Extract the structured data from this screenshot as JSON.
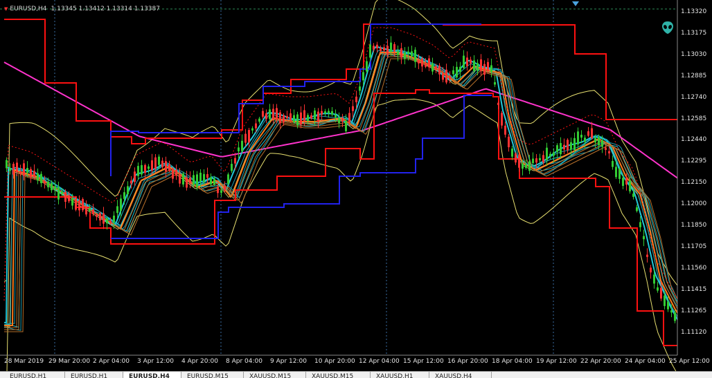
{
  "chart": {
    "symbol_line": "EURUSD,H4",
    "ohlc": "1.13345 1.13412 1.13314 1.13387",
    "colors": {
      "background": "#000000",
      "bull": "#33cc33",
      "bear": "#ff3333",
      "price_channel": "#ff1111",
      "donchian_blue": "#2222ee",
      "ma_magenta": "#ff33cc",
      "bollinger": "#e8e070",
      "cyan_ribbon": "#22c8d8",
      "orange_ribbon": "#ff7a1a",
      "grid": "#3a6ea5"
    },
    "price_axis": [
      "1.13320",
      "1.13175",
      "1.13030",
      "1.12885",
      "1.12740",
      "1.12585",
      "1.12440",
      "1.12295",
      "1.12150",
      "1.12000",
      "1.11850",
      "1.11705",
      "1.11560",
      "1.11415",
      "1.11265",
      "1.11120"
    ],
    "time_axis": [
      "28 Mar 2019",
      "29 Mar 20:00",
      "2 Apr 04:00",
      "3 Apr 12:00",
      "4 Apr 20:00",
      "8 Apr 04:00",
      "9 Apr 12:00",
      "10 Apr 20:00",
      "12 Apr 04:00",
      "15 Apr 12:00",
      "16 Apr 20:00",
      "18 Apr 04:00",
      "19 Apr 12:00",
      "22 Apr 20:00",
      "24 Apr 04:00",
      "25 Apr 12:00"
    ]
  },
  "tabs": [
    {
      "label": "EURUSD,H1",
      "active": false
    },
    {
      "label": "EURUSD,H1",
      "active": false
    },
    {
      "label": "EURUSD,H4",
      "active": true
    },
    {
      "label": "EURUSD,M15",
      "active": false
    },
    {
      "label": "XAUUSD,M15",
      "active": false
    },
    {
      "label": "XAUUSD,M15",
      "active": false
    },
    {
      "label": "XAUUSD,H1",
      "active": false
    },
    {
      "label": "XAUUSD,H4",
      "active": false
    }
  ]
}
